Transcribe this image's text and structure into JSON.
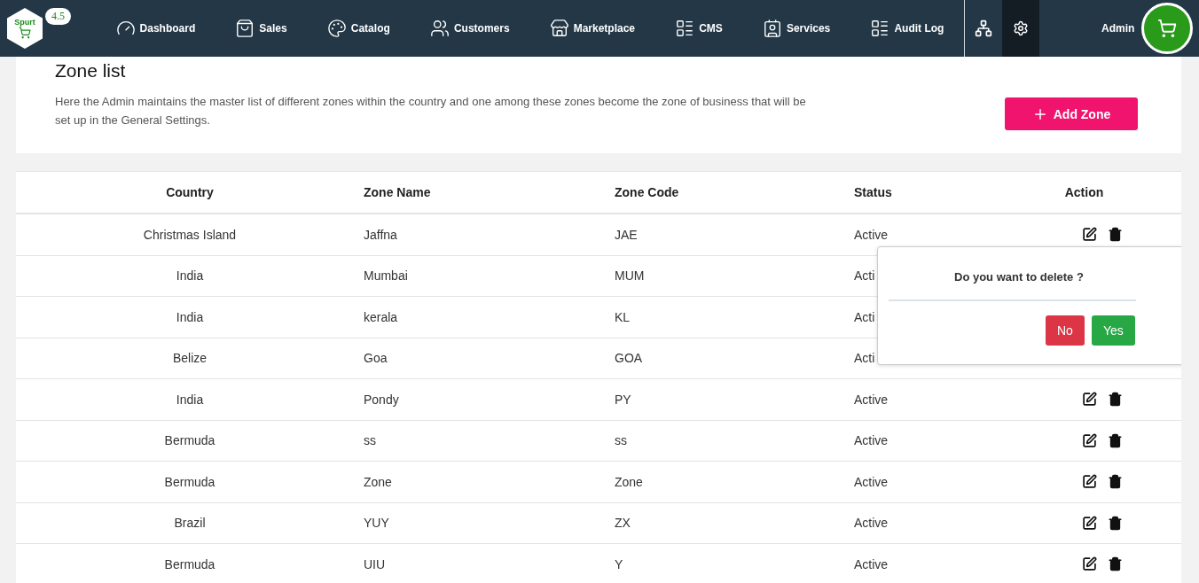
{
  "header": {
    "logo_text": "Spurt",
    "version": "4.5",
    "nav": [
      {
        "label": "Dashboard"
      },
      {
        "label": "Sales"
      },
      {
        "label": "Catalog"
      },
      {
        "label": "Customers"
      },
      {
        "label": "Marketplace"
      },
      {
        "label": "CMS"
      },
      {
        "label": "Services"
      },
      {
        "label": "Audit Log"
      }
    ],
    "settings_selected": true,
    "user": "Admin"
  },
  "page": {
    "title": "Zone list",
    "description": "Here the Admin maintains the master list of different zones within the country and one among these zones become the zone of business that will be set up in the General Settings.",
    "add_button": "Add Zone"
  },
  "table": {
    "columns": [
      "Country",
      "Zone Name",
      "Zone Code",
      "Status",
      "Action"
    ],
    "rows": [
      {
        "country": "Christmas Island",
        "zone_name": "Jaffna",
        "zone_code": "JAE",
        "status": "Active",
        "actions_visible": true
      },
      {
        "country": "India",
        "zone_name": "Mumbai",
        "zone_code": "MUM",
        "status": "Acti",
        "actions_visible": false
      },
      {
        "country": "India",
        "zone_name": "kerala",
        "zone_code": "KL",
        "status": "Acti",
        "actions_visible": false
      },
      {
        "country": "Belize",
        "zone_name": "Goa",
        "zone_code": "GOA",
        "status": "Acti",
        "actions_visible": false
      },
      {
        "country": "India",
        "zone_name": "Pondy",
        "zone_code": "PY",
        "status": "Active",
        "actions_visible": true
      },
      {
        "country": "Bermuda",
        "zone_name": "ss",
        "zone_code": "ss",
        "status": "Active",
        "actions_visible": true
      },
      {
        "country": "Bermuda",
        "zone_name": "Zone",
        "zone_code": "Zone",
        "status": "Active",
        "actions_visible": true
      },
      {
        "country": "Brazil",
        "zone_name": "YUY",
        "zone_code": "ZX",
        "status": "Active",
        "actions_visible": true
      },
      {
        "country": "Bermuda",
        "zone_name": "UIU",
        "zone_code": "Y",
        "status": "Active",
        "actions_visible": true
      }
    ]
  },
  "delete_popover": {
    "message": "Do you want to delete ?",
    "no": "No",
    "yes": "Yes"
  }
}
